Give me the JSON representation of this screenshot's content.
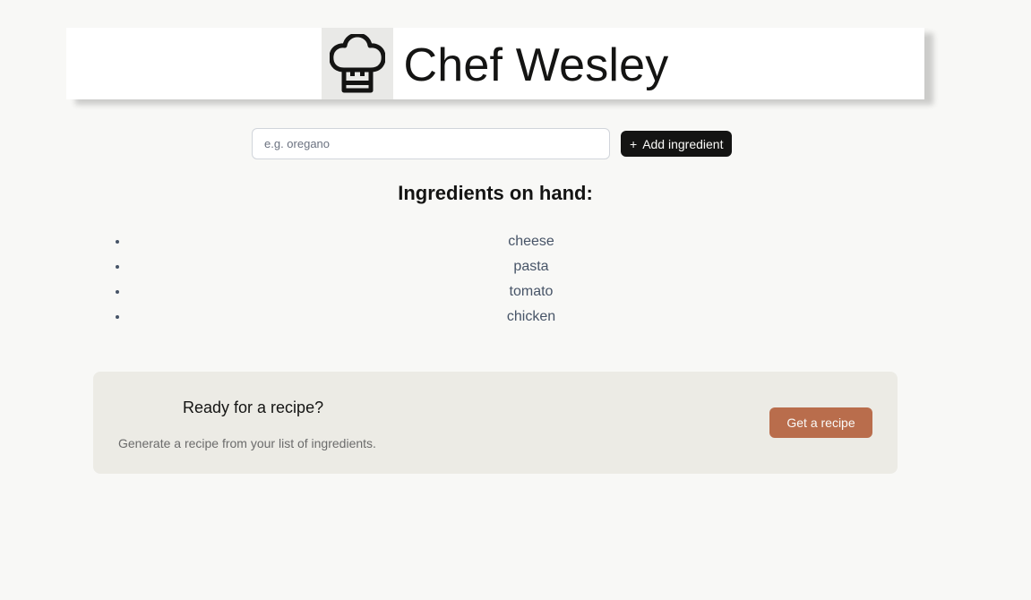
{
  "header": {
    "logo_icon": "chef-hat-icon",
    "title": "Chef Wesley"
  },
  "form": {
    "input_value": "",
    "input_placeholder": "e.g. oregano",
    "add_button_icon": "plus-icon",
    "add_button_label": "Add ingredient"
  },
  "ingredients": {
    "title": "Ingredients on hand:",
    "items": [
      "cheese",
      "pasta",
      "tomato",
      "chicken"
    ]
  },
  "recipe_cta": {
    "heading": "Ready for a recipe?",
    "description": "Generate a recipe from your list of ingredients.",
    "button_label": "Get a recipe"
  },
  "colors": {
    "page_background": "#f8f8f6",
    "primary_dark": "#141413",
    "card_background": "#ecebe5",
    "accent": "#b96d4c",
    "list_text": "#475467"
  }
}
